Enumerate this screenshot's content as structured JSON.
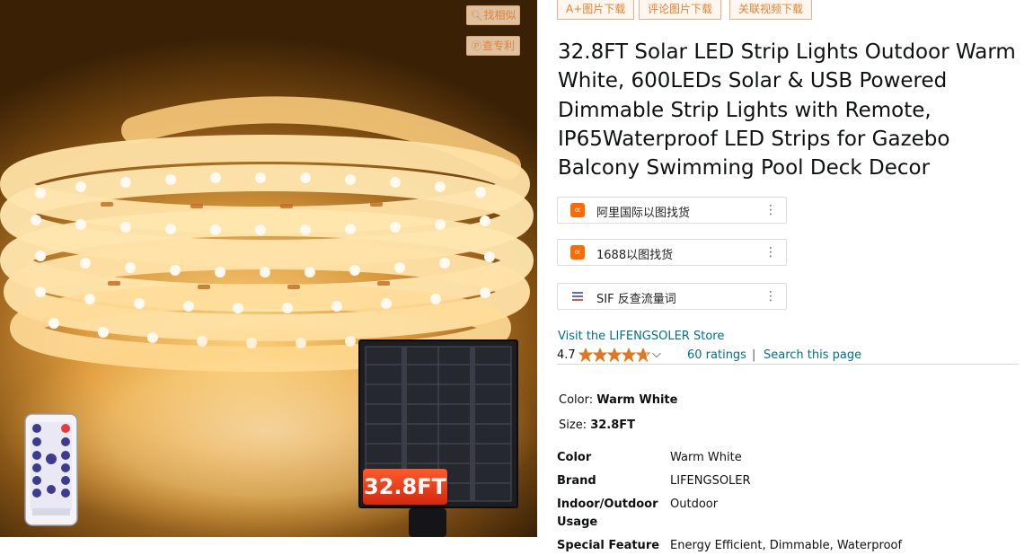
{
  "image_overlay": {
    "find_similar": "找相似",
    "check_patent": "查专利",
    "size_badge": "32.8FT"
  },
  "top_buttons": [
    "A+图片下载",
    "评论图片下载",
    "关联视频下载"
  ],
  "product": {
    "title": "32.8FT Solar LED Strip Lights Outdoor Warm White, 600LEDs Solar & USB Powered Dimmable Strip Lights with Remote, IP65Waterproof LED Strips for Gazebo Balcony Swimming Pool Deck Decor"
  },
  "plugins": [
    {
      "label": "阿里国际以图找货",
      "icon": "alibaba-icon"
    },
    {
      "label": "1688以图找货",
      "icon": "1688-icon"
    },
    {
      "label": "SIF 反查流量词",
      "icon": "sif-icon"
    }
  ],
  "store": {
    "link_text": "Visit the LIFENGSOLER Store"
  },
  "rating": {
    "value": "4.7",
    "stars": 4.7,
    "count_text": "60 ratings",
    "separator": "|",
    "search_text": "Search this page"
  },
  "variations": {
    "color_label": "Color:",
    "color_value": "Warm White",
    "size_label": "Size:",
    "size_value": "32.8FT"
  },
  "specs": [
    {
      "key": "Color",
      "value": "Warm White"
    },
    {
      "key": "Brand",
      "value": "LIFENGSOLER"
    },
    {
      "key": "Indoor/Outdoor Usage",
      "value": "Outdoor"
    },
    {
      "key": "Special Feature",
      "value": "Energy Efficient, Dimmable, Waterproof"
    }
  ],
  "colors": {
    "link": "#007185",
    "star": "#de7921",
    "overlay_orange": "#e0833a",
    "badge_red": "#e2401a"
  }
}
